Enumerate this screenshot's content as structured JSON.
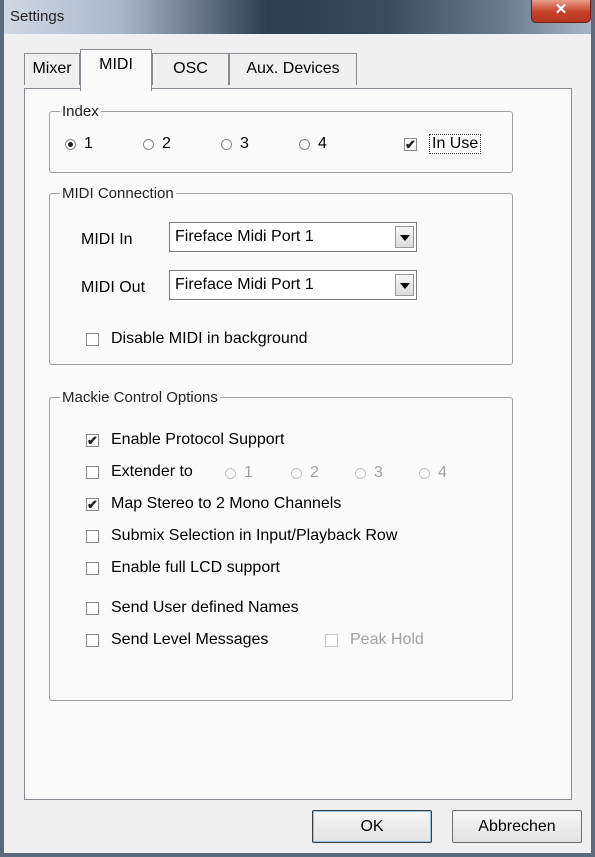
{
  "window": {
    "title": "Settings",
    "close_glyph": "✕"
  },
  "tabs": [
    {
      "label": "Mixer",
      "active": false
    },
    {
      "label": "MIDI",
      "active": true
    },
    {
      "label": "OSC",
      "active": false
    },
    {
      "label": "Aux. Devices",
      "active": false
    }
  ],
  "index_group": {
    "legend": "Index",
    "options": [
      "1",
      "2",
      "3",
      "4"
    ],
    "selected": "1",
    "in_use_label": "In Use",
    "in_use_checked": true
  },
  "midi_connection": {
    "legend": "MIDI Connection",
    "midi_in_label": "MIDI In",
    "midi_in_value": "Fireface Midi Port 1",
    "midi_out_label": "MIDI Out",
    "midi_out_value": "Fireface Midi Port 1",
    "disable_background_label": "Disable MIDI in background",
    "disable_background_checked": false
  },
  "mackie": {
    "legend": "Mackie Control Options",
    "enable_protocol_label": "Enable Protocol Support",
    "enable_protocol_checked": true,
    "extender_label": "Extender to",
    "extender_checked": false,
    "extender_options": [
      "1",
      "2",
      "3",
      "4"
    ],
    "map_stereo_label": "Map Stereo to 2 Mono Channels",
    "map_stereo_checked": true,
    "submix_label": "Submix Selection in Input/Playback Row",
    "submix_checked": false,
    "full_lcd_label": "Enable full LCD support",
    "full_lcd_checked": false,
    "user_names_label": "Send User defined Names",
    "user_names_checked": false,
    "level_messages_label": "Send Level Messages",
    "level_messages_checked": false,
    "peak_hold_label": "Peak Hold",
    "peak_hold_checked": false
  },
  "buttons": {
    "ok": "OK",
    "cancel": "Abbrechen"
  },
  "check_glyph": "✔"
}
